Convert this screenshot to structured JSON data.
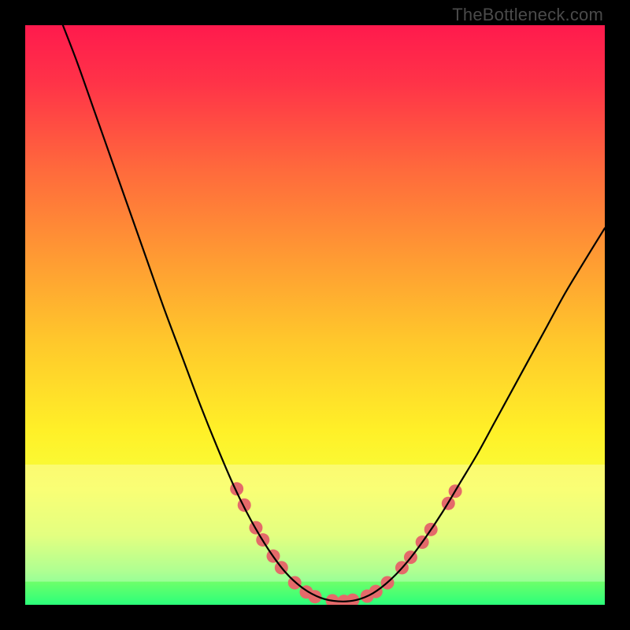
{
  "watermark": "TheBottleneck.com",
  "gradient": {
    "stops": [
      {
        "offset": 0.0,
        "color": "#ff1a4d"
      },
      {
        "offset": 0.1,
        "color": "#ff3348"
      },
      {
        "offset": 0.25,
        "color": "#ff6a3c"
      },
      {
        "offset": 0.4,
        "color": "#ff9a33"
      },
      {
        "offset": 0.55,
        "color": "#ffc92b"
      },
      {
        "offset": 0.7,
        "color": "#fff028"
      },
      {
        "offset": 0.8,
        "color": "#f7ff3a"
      },
      {
        "offset": 0.88,
        "color": "#d8ff4a"
      },
      {
        "offset": 0.94,
        "color": "#8fff62"
      },
      {
        "offset": 1.0,
        "color": "#2bff7a"
      }
    ]
  },
  "pale_band": {
    "top_frac": 0.758,
    "bottom_frac": 0.96,
    "color": "#ffffff",
    "opacity": 0.3
  },
  "chart_data": {
    "type": "line",
    "title": "",
    "subtitle": "",
    "xlabel": "",
    "ylabel": "",
    "xlim": [
      0,
      100
    ],
    "ylim": [
      0,
      100
    ],
    "grid": false,
    "legend": null,
    "annotations": [],
    "series": [
      {
        "name": "curve",
        "color": "#000000",
        "stroke_width": 2.2,
        "points": [
          {
            "x": 6.5,
            "y": 100.0
          },
          {
            "x": 9.0,
            "y": 93.5
          },
          {
            "x": 12.0,
            "y": 85.0
          },
          {
            "x": 15.0,
            "y": 76.5
          },
          {
            "x": 18.0,
            "y": 68.0
          },
          {
            "x": 21.0,
            "y": 59.5
          },
          {
            "x": 24.0,
            "y": 51.0
          },
          {
            "x": 27.0,
            "y": 43.0
          },
          {
            "x": 30.0,
            "y": 35.0
          },
          {
            "x": 33.0,
            "y": 27.5
          },
          {
            "x": 36.0,
            "y": 20.5
          },
          {
            "x": 39.0,
            "y": 14.5
          },
          {
            "x": 42.0,
            "y": 9.5
          },
          {
            "x": 45.0,
            "y": 5.5
          },
          {
            "x": 48.0,
            "y": 2.8
          },
          {
            "x": 51.0,
            "y": 1.2
          },
          {
            "x": 54.0,
            "y": 0.6
          },
          {
            "x": 57.0,
            "y": 0.8
          },
          {
            "x": 60.0,
            "y": 2.0
          },
          {
            "x": 63.0,
            "y": 4.3
          },
          {
            "x": 66.0,
            "y": 7.5
          },
          {
            "x": 69.0,
            "y": 11.5
          },
          {
            "x": 72.0,
            "y": 16.0
          },
          {
            "x": 75.0,
            "y": 21.0
          },
          {
            "x": 78.0,
            "y": 26.0
          },
          {
            "x": 81.0,
            "y": 31.5
          },
          {
            "x": 84.0,
            "y": 37.0
          },
          {
            "x": 87.0,
            "y": 42.5
          },
          {
            "x": 90.0,
            "y": 48.0
          },
          {
            "x": 93.0,
            "y": 53.5
          },
          {
            "x": 96.0,
            "y": 58.5
          },
          {
            "x": 100.0,
            "y": 65.0
          }
        ]
      },
      {
        "name": "markers",
        "type": "scatter",
        "color": "#e46a6a",
        "radius": 8.5,
        "points": [
          {
            "x": 36.5,
            "y": 20.0
          },
          {
            "x": 37.8,
            "y": 17.2
          },
          {
            "x": 39.8,
            "y": 13.3
          },
          {
            "x": 41.0,
            "y": 11.2
          },
          {
            "x": 42.8,
            "y": 8.4
          },
          {
            "x": 44.2,
            "y": 6.4
          },
          {
            "x": 46.5,
            "y": 3.8
          },
          {
            "x": 48.5,
            "y": 2.2
          },
          {
            "x": 50.0,
            "y": 1.4
          },
          {
            "x": 53.0,
            "y": 0.7
          },
          {
            "x": 55.0,
            "y": 0.6
          },
          {
            "x": 56.5,
            "y": 0.8
          },
          {
            "x": 59.0,
            "y": 1.5
          },
          {
            "x": 60.5,
            "y": 2.3
          },
          {
            "x": 62.5,
            "y": 3.8
          },
          {
            "x": 65.0,
            "y": 6.4
          },
          {
            "x": 66.5,
            "y": 8.2
          },
          {
            "x": 68.5,
            "y": 10.8
          },
          {
            "x": 70.0,
            "y": 13.0
          },
          {
            "x": 73.0,
            "y": 17.5
          },
          {
            "x": 74.2,
            "y": 19.6
          }
        ]
      }
    ]
  }
}
